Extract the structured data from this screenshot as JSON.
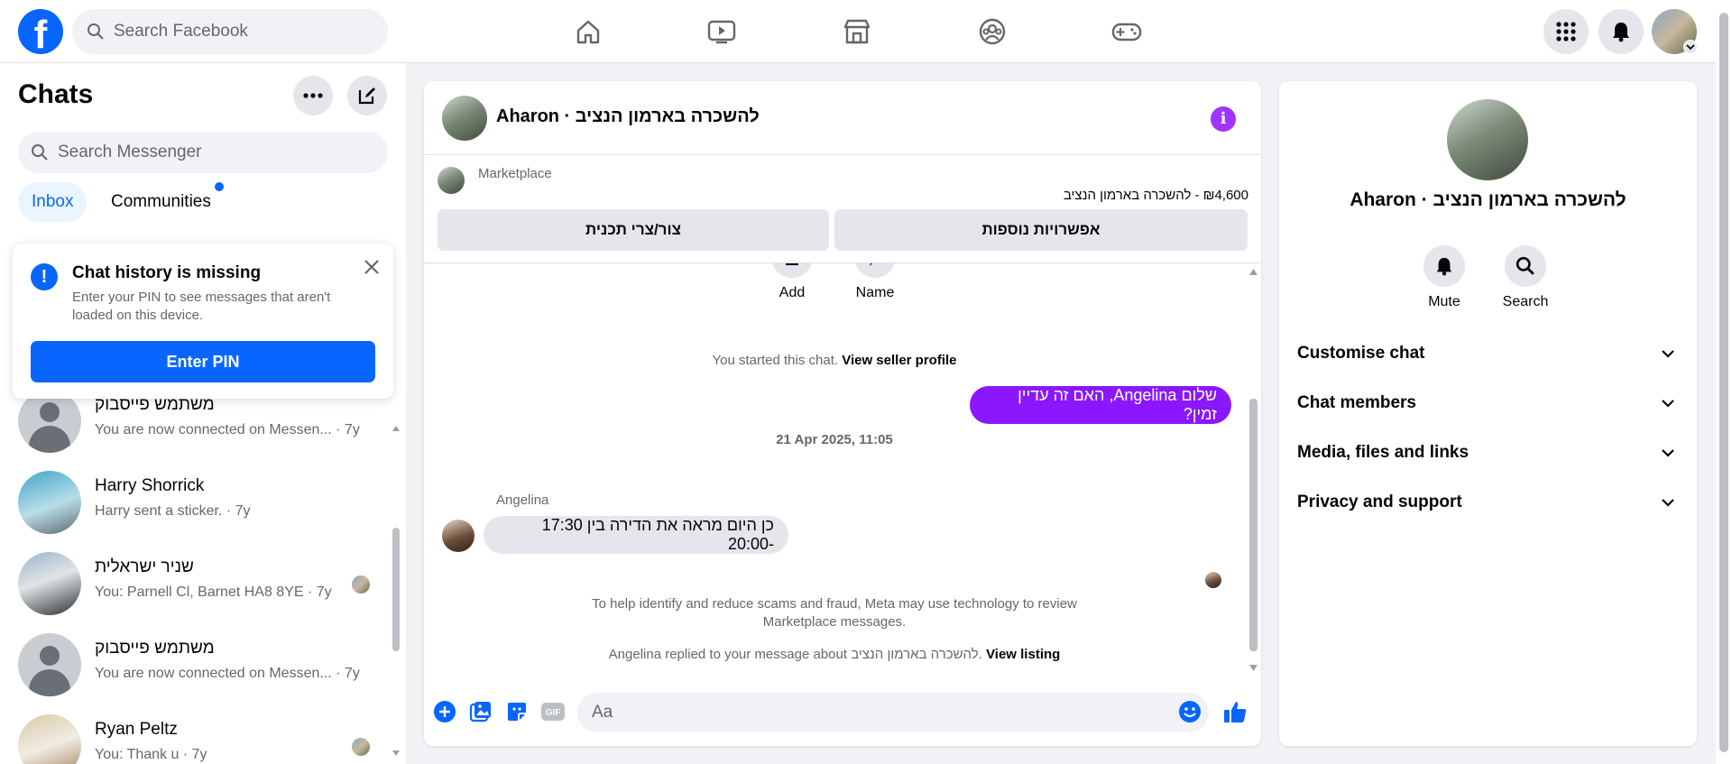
{
  "topbar": {
    "search_placeholder": "Search Facebook",
    "nav_icons": [
      "home-icon",
      "video-icon",
      "marketplace-icon",
      "groups-icon",
      "gaming-icon"
    ],
    "brand_color": "#0866ff"
  },
  "left": {
    "title": "Chats",
    "search_placeholder": "Search Messenger",
    "tabs": [
      {
        "label": "Inbox"
      },
      {
        "label": "Communities"
      }
    ],
    "pin_card": {
      "title": "Chat history is missing",
      "description": "Enter your PIN to see messages that aren't loaded on this device.",
      "button": "Enter PIN"
    },
    "chats": [
      {
        "name": "משתמש פייסבוק",
        "preview": "You are now connected on Messen...",
        "time": "· 7y"
      },
      {
        "name": "Harry Shorrick",
        "preview": "Harry sent a sticker.",
        "time": "· 7y"
      },
      {
        "name": "שניר ישראלית",
        "preview": "You: Parnell Cl, Barnet HA8 8YE",
        "time": "· 7y"
      },
      {
        "name": "משתמש פייסבוק",
        "preview": "You are now connected on Messen...",
        "time": "· 7y"
      },
      {
        "name": "Ryan Peltz",
        "preview": "You: Thank u",
        "time": "· 7y"
      }
    ]
  },
  "conversation": {
    "title": "Aharon · להשכרה בארמון הנציב",
    "marketplace_label": "Marketplace",
    "listing_price": "₪4,600 - להשכרה בארמון הנציב",
    "buttons": {
      "more_options": "אפשרויות נוספות",
      "contact": "צור/צרי תכנית"
    },
    "top_actions": [
      {
        "label": "Add"
      },
      {
        "label": "Name"
      }
    ],
    "started_text": "You started this chat.",
    "view_seller_profile": "View seller profile",
    "outgoing_message": "שלום Angelina, האם זה עדיין זמין?",
    "date_stamp": "21 Apr 2025, 11:05",
    "incoming_sender": "Angelina",
    "incoming_message": "כן היום מראה את הדירה בין 17:30 -20:00",
    "scam_notice": "To help identify and reduce scams and fraud, Meta may use technology to review Marketplace messages.",
    "replied_text": "Angelina replied to your message about להשכרה בארמון הנציב.",
    "view_listing": "View listing",
    "composer_placeholder": "Aa",
    "accent_color": "#8a17ff"
  },
  "right": {
    "name": "Aharon · להשכרה בארמון הנציב",
    "actions": [
      {
        "label": "Mute"
      },
      {
        "label": "Search"
      }
    ],
    "sections": [
      {
        "label": "Customise chat"
      },
      {
        "label": "Chat members"
      },
      {
        "label": "Media, files and links"
      },
      {
        "label": "Privacy and support"
      }
    ]
  }
}
